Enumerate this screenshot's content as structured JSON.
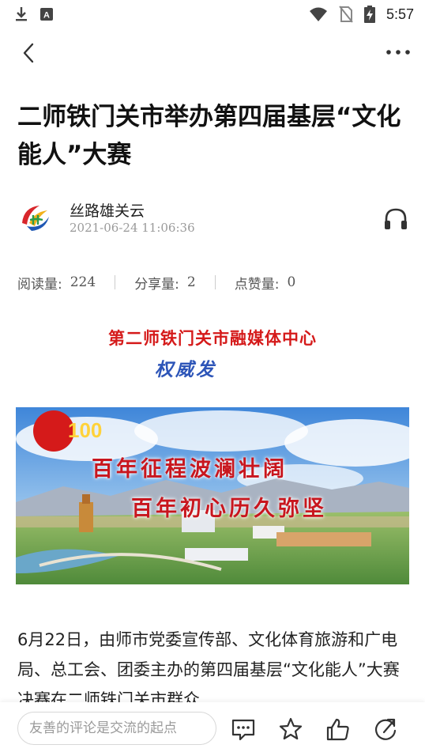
{
  "status_bar": {
    "time": "5:57",
    "icons": [
      "download-icon",
      "app-a-icon",
      "wifi-icon",
      "no-sim-icon",
      "battery-charging-icon"
    ]
  },
  "nav": {
    "back_icon": "chevron-left-icon",
    "more_icon": "more-dots-icon"
  },
  "article": {
    "title": "二师铁门关市举办第四届基层“文化能人”大赛",
    "author": "丝路雄关云",
    "published": "2021-06-24 11:06:36",
    "stats": [
      {
        "label": "阅读量:",
        "value": "224"
      },
      {
        "label": "分享量:",
        "value": "2"
      },
      {
        "label": "点赞量:",
        "value": "0"
      }
    ],
    "banner_line1": "第二师铁门关市融媒体中心",
    "banner_line2": "权威发",
    "hero_slogan_1": "百年征程波澜壮阔",
    "hero_slogan_2": "百年初心历久弥坚",
    "body": "6月22日，由师市党委宣传部、文化体育旅游和广电局、总工会、团委主办的第四届基层“文化能人”大赛决赛在二师铁门关市群众"
  },
  "bottom_bar": {
    "comment_placeholder": "友善的评论是交流的起点",
    "icons": [
      "comment-icon",
      "favorite-star-icon",
      "like-thumb-icon",
      "share-icon"
    ]
  },
  "colors": {
    "banner_red": "#d51a1a",
    "banner_blue": "#2d55b8",
    "slogan_red": "#c8161e"
  }
}
